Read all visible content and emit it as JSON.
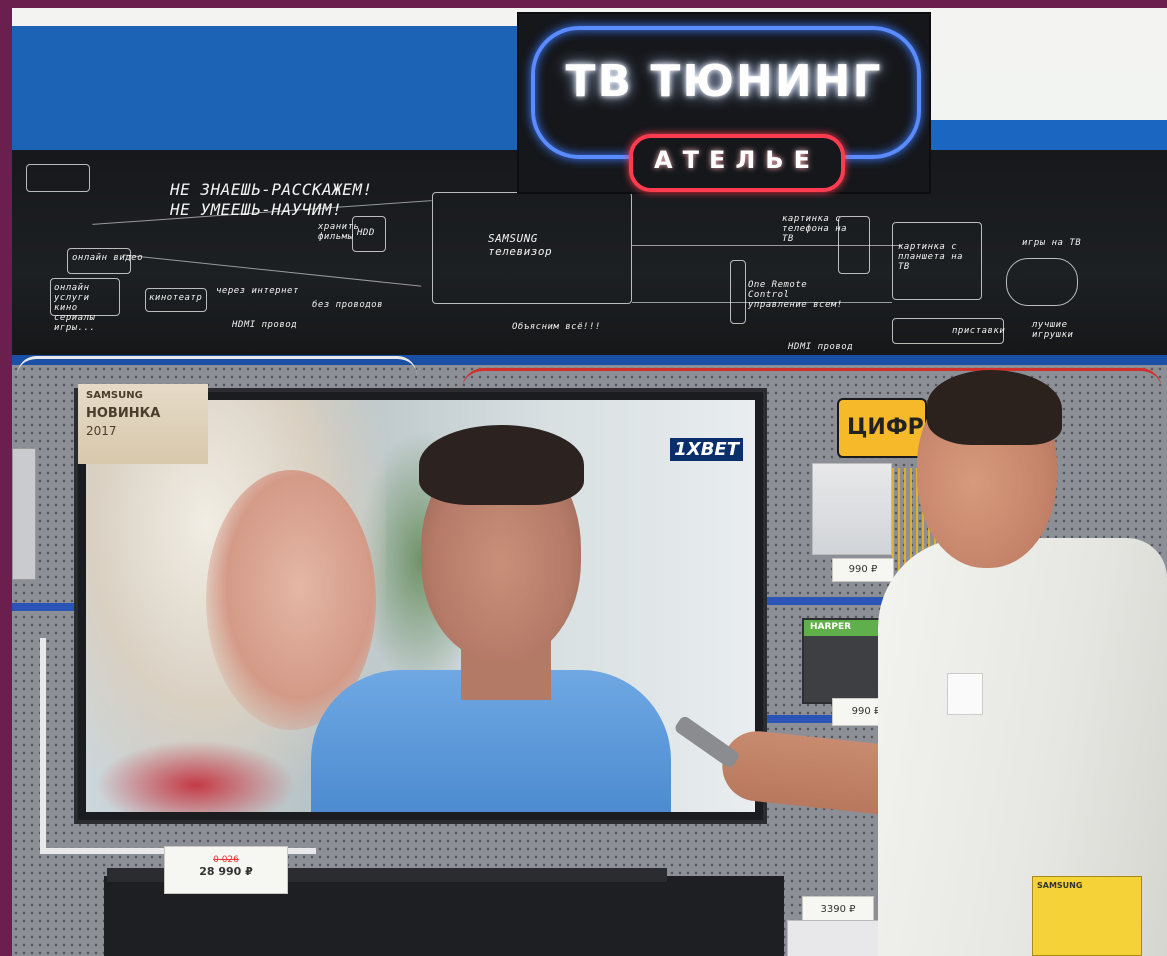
{
  "sign": {
    "title": "ТВ ТЮНИНГ",
    "subtitle": "АТЕЛЬЕ"
  },
  "chalkboard": {
    "slogan_line1": "НЕ ЗНАЕШЬ-РАССКАЖЕМ!",
    "slogan_line2": "НЕ УМЕЕШЬ-НАУЧИМ!",
    "samsung_tv": "SAMSUNG телевизор",
    "hdd_label": "HDD",
    "record_label": "хранить фильмы",
    "online_video": "онлайн видео",
    "online_services": "онлайн услуги кино сериалы игры...",
    "cinema": "кинотеатр",
    "via_internet": "через интернет",
    "wireless": "без проводов",
    "hdmi": "HDMI провод",
    "phone_picture": "картинка с телефона на ТВ",
    "tablet_picture": "картинка с планшета на ТВ",
    "games_tv": "игры на ТВ",
    "one_remote": "One Remote Control управление всем!",
    "best_toys": "лучшие игрушки",
    "accessories": "приставки",
    "hdmi2": "HDMI провод",
    "explain": "Объясним всё!!!"
  },
  "tv": {
    "badge_brand": "SAMSUNG",
    "badge_new": "НОВИНКА",
    "badge_year": "2017",
    "ad_logo": "1XBET"
  },
  "price_tags": {
    "main_old": "0 026",
    "main_price": "28 990 ₽",
    "product1": "990 ₽",
    "product2": "990 ₽",
    "product3": "3390 ₽"
  },
  "shelf": {
    "cifra_sign": "ЦИФР",
    "harper_brand": "HARPER"
  },
  "badge_doc": {
    "brand": "SAMSUNG"
  }
}
